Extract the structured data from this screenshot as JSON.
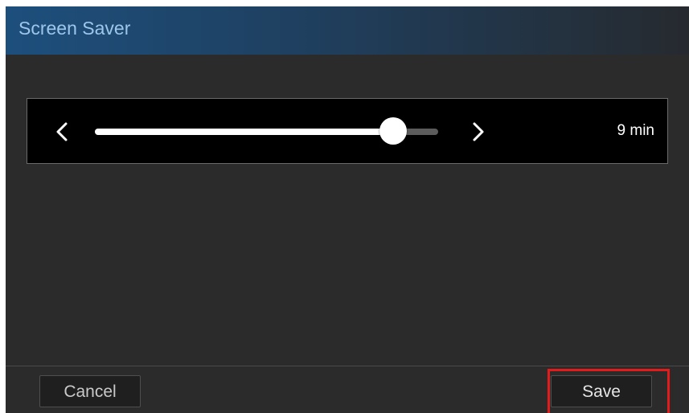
{
  "dialog": {
    "title": "Screen Saver"
  },
  "slider": {
    "value_text": "9 min",
    "fill_fraction": 0.87,
    "prev_icon": "chevron-left-icon",
    "next_icon": "chevron-right-icon"
  },
  "footer": {
    "cancel_label": "Cancel",
    "save_label": "Save"
  },
  "colors": {
    "title_text": "#9ec6ea",
    "highlight": "#e31b1b"
  }
}
